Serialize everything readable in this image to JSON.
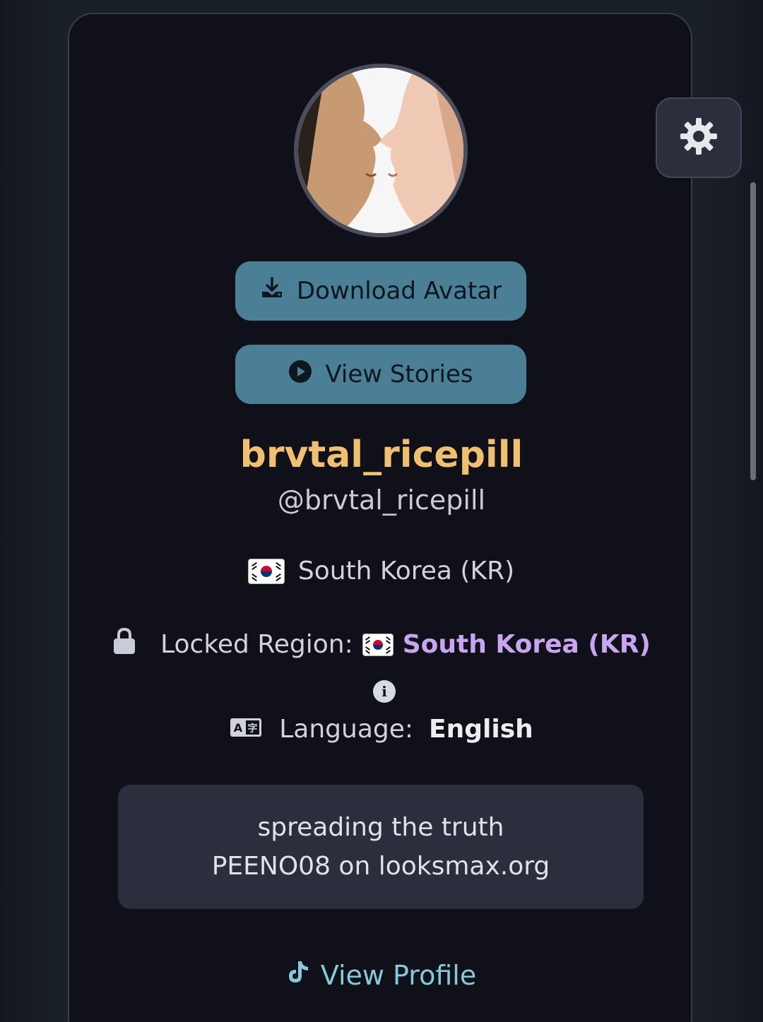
{
  "avatar": {
    "download_label": "Download Avatar",
    "alt": "profile avatar"
  },
  "stories": {
    "label": "View Stories"
  },
  "profile": {
    "display_name": "brvtal_ricepill",
    "handle": "@brvtal_ricepill",
    "country": "South Korea (KR)",
    "locked_region_label": "Locked Region:",
    "locked_region_value": "South Korea (KR)",
    "language_label": "Language:",
    "language_value": "English",
    "bio_line1": "spreading the truth",
    "bio_line2": "PEENO08 on looksmax.org"
  },
  "footer": {
    "view_profile_label": "View Profile"
  },
  "icons": {
    "settings": "gear-icon",
    "download": "download-icon",
    "play": "play-circle-icon",
    "lock": "lock-icon",
    "info": "info-icon",
    "language": "translate-icon",
    "tiktok": "tiktok-icon",
    "flag": "flag-kr-icon"
  },
  "colors": {
    "display_name": "#f0c070",
    "locked_region": "#c9a4f0",
    "button_bg": "#4a7f96",
    "link": "#86c9dc",
    "card_bg": "#0f1018",
    "bio_bg": "#2d2e3d"
  }
}
